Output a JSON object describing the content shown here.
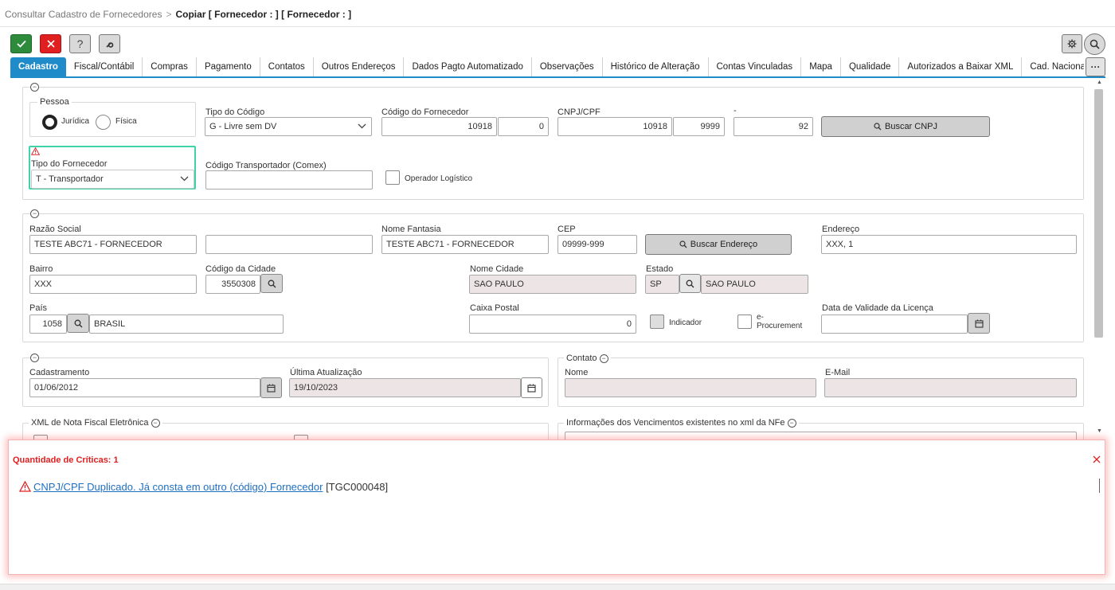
{
  "breadcrumb": {
    "parent": "Consultar Cadastro de Fornecedores",
    "separator": ">",
    "current": "Copiar [ Fornecedor : ] [ Fornecedor : ]"
  },
  "toolbar": {
    "confirm_icon": "check-icon",
    "cancel_icon": "close-icon",
    "help_label": "?",
    "settings_icon": "wrench-icon"
  },
  "tabs": [
    "Cadastro",
    "Fiscal/Contábil",
    "Compras",
    "Pagamento",
    "Contatos",
    "Outros Endereços",
    "Dados Pagto Automatizado",
    "Observações",
    "Histórico de Alteração",
    "Contas Vinculadas",
    "Mapa",
    "Qualidade",
    "Autorizados a Baixar XML",
    "Cad. Nacional Obras (CNO)"
  ],
  "more_label": "···",
  "section1": {
    "pessoa": {
      "legend": "Pessoa",
      "option1": "Jurídica",
      "option2": "Física",
      "selected": "Jurídica"
    },
    "tipo_codigo": {
      "label": "Tipo do Código",
      "value": "G - Livre sem DV"
    },
    "codigo_fornecedor": {
      "label": "Código do Fornecedor",
      "value1": "10918",
      "value2": "0"
    },
    "cnpj": {
      "label": "CNPJ/CPF",
      "value1": "10918",
      "value2": "9999"
    },
    "dash": {
      "label": "-",
      "value": "92"
    },
    "buscar_cnpj": "Buscar CNPJ",
    "tipo_fornecedor": {
      "label": "Tipo do Fornecedor",
      "value": "T - Transportador"
    },
    "codigo_transportador": {
      "label": "Código Transportador (Comex)",
      "value": ""
    },
    "operador_logistico": "Operador Logístico"
  },
  "section2": {
    "razao_social": {
      "label": "Razão Social",
      "value": "TESTE ABC71 - FORNECEDOR",
      "value2": ""
    },
    "nome_fantasia": {
      "label": "Nome Fantasia",
      "value": "TESTE ABC71 - FORNECEDOR"
    },
    "cep": {
      "label": "CEP",
      "value": "09999-999"
    },
    "buscar_endereco": "Buscar Endereço",
    "endereco": {
      "label": "Endereço",
      "value": "XXX, 1"
    },
    "bairro": {
      "label": "Bairro",
      "value": "XXX"
    },
    "codigo_cidade": {
      "label": "Código da Cidade",
      "value": "3550308"
    },
    "nome_cidade": {
      "label": "Nome Cidade",
      "value": "SAO PAULO"
    },
    "estado": {
      "label": "Estado",
      "code": "SP",
      "name": "SAO PAULO"
    },
    "pais": {
      "label": "País",
      "code": "1058",
      "name": "BRASIL"
    },
    "caixa_postal": {
      "label": "Caixa Postal",
      "value": "0"
    },
    "indicador": "Indicador",
    "eprocurement1": "e-",
    "eprocurement2": "Procurement",
    "data_validade": {
      "label": "Data de Validade da Licença",
      "value": ""
    }
  },
  "section3": {
    "cadastramento": {
      "label": "Cadastramento",
      "value": "01/06/2012"
    },
    "ultima_atualizacao": {
      "label": "Última Atualização",
      "value": "19/10/2023"
    },
    "contato": {
      "legend": "Contato",
      "nome_label": "Nome",
      "nome_value": "",
      "email_label": "E-Mail",
      "email_value": ""
    }
  },
  "section4": {
    "xml_legend": "XML de Nota Fiscal Eletrônica",
    "venc_legend": "Informações dos Vencimentos existentes no xml da NFe"
  },
  "errors": {
    "title": "Quantidade de Críticas: 1",
    "message": "CNPJ/CPF Duplicado. Já consta em outro (código) Fornecedor",
    "code": "[TGC000048]"
  },
  "colors": {
    "accent": "#1f8cc9",
    "ok": "#2e8b3b",
    "cancel": "#e02020",
    "error": "#e02020",
    "highlight": "#3ed3a8"
  }
}
